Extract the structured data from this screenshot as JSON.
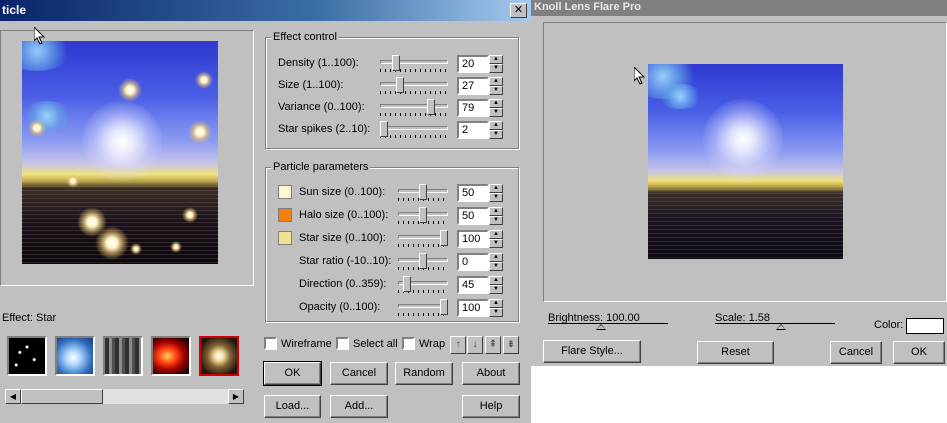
{
  "particle": {
    "title": "ticle",
    "close_glyph": "✕",
    "effect_control": {
      "title": "Effect control",
      "rows": [
        {
          "label": "Density (1..100):",
          "value": "20",
          "level": 0.2
        },
        {
          "label": "Size (1..100):",
          "value": "27",
          "level": 0.27
        },
        {
          "label": "Variance (0..100):",
          "value": "79",
          "level": 0.79
        },
        {
          "label": "Star spikes (2..10):",
          "value": "2",
          "level": 0.0
        }
      ]
    },
    "particle_parameters": {
      "title": "Particle parameters",
      "rows": [
        {
          "label": "Sun size (0..100):",
          "value": "50",
          "level": 0.5,
          "swatch": "#fff8d0"
        },
        {
          "label": "Halo size (0..100):",
          "value": "50",
          "level": 0.5,
          "swatch": "#f08010"
        },
        {
          "label": "Star size (0..100):",
          "value": "100",
          "level": 1.0,
          "swatch": "#f0e090"
        },
        {
          "label": "Star ratio (-10..10):",
          "value": "0",
          "level": 0.5
        },
        {
          "label": "Direction (0..359):",
          "value": "45",
          "level": 0.125
        },
        {
          "label": "Opacity (0..100):",
          "value": "100",
          "level": 1.0
        }
      ]
    },
    "effect_label": "Effect: Star",
    "checkboxes": {
      "wireframe": "Wireframe",
      "select_all": "Select all",
      "wrap": "Wrap"
    },
    "arrow_glyphs": [
      "↑",
      "↓",
      "⇞",
      "⇟"
    ],
    "buttons": {
      "ok": "OK",
      "cancel": "Cancel",
      "random": "Random",
      "about": "About",
      "load": "Load...",
      "add": "Add...",
      "help": "Help"
    },
    "scroll_glyphs": {
      "left": "◀",
      "right": "▶"
    }
  },
  "knoll": {
    "title": "Knoll Lens Flare Pro",
    "brightness_label": "Brightness: 100.00",
    "scale_label": "Scale: 1.58",
    "color_label": "Color:",
    "color_value": "#ffffff",
    "buttons": {
      "flare_style": "Flare Style...",
      "reset": "Reset",
      "cancel": "Cancel",
      "ok": "OK"
    }
  }
}
